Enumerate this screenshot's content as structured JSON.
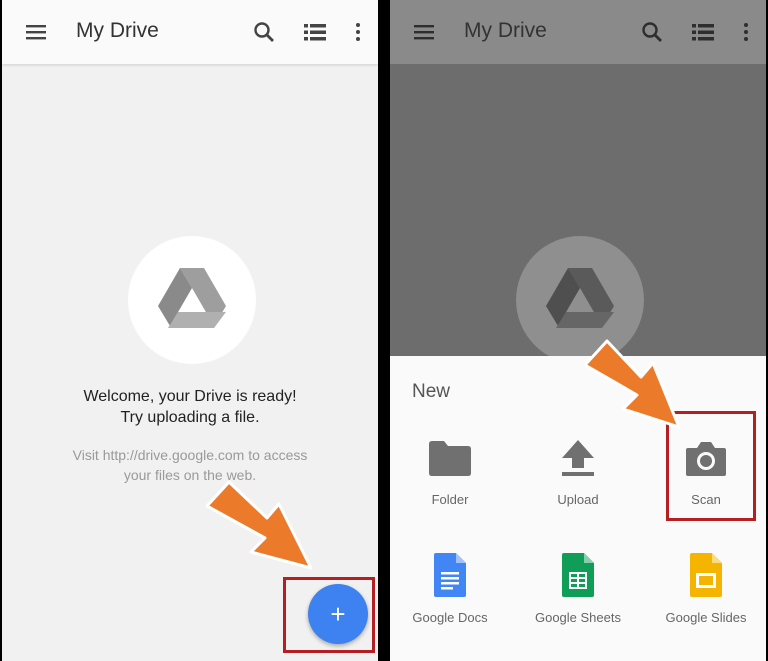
{
  "left_screen": {
    "appbar": {
      "title": "My Drive",
      "menu_icon": "hamburger-menu-icon",
      "search_icon": "search-icon",
      "view_icon": "list-view-icon",
      "more_icon": "more-vert-icon"
    },
    "empty_state": {
      "logo_icon": "google-drive-icon",
      "welcome_line1": "Welcome, your Drive is ready!",
      "welcome_line2": "Try uploading a file.",
      "hint_line1": "Visit http://drive.google.com to access",
      "hint_line2": "your files on the web."
    },
    "fab": {
      "label": "+",
      "icon": "add-icon"
    }
  },
  "right_screen": {
    "appbar": {
      "title": "My Drive",
      "menu_icon": "hamburger-menu-icon",
      "search_icon": "search-icon",
      "view_icon": "list-view-icon",
      "more_icon": "more-vert-icon"
    },
    "new_sheet": {
      "title": "New",
      "items": [
        {
          "label": "Folder",
          "icon": "folder-icon"
        },
        {
          "label": "Upload",
          "icon": "upload-icon"
        },
        {
          "label": "Scan",
          "icon": "camera-icon"
        },
        {
          "label": "Google Docs",
          "icon": "google-docs-icon"
        },
        {
          "label": "Google Sheets",
          "icon": "google-sheets-icon"
        },
        {
          "label": "Google Slides",
          "icon": "google-slides-icon"
        }
      ]
    }
  },
  "colors": {
    "fab_blue": "#3d82f0",
    "highlight_red": "#b41f24",
    "arrow_orange": "#ec7a2b",
    "docs_blue": "#4285f4",
    "sheets_green": "#0f9d58",
    "slides_yellow": "#f4b400"
  }
}
